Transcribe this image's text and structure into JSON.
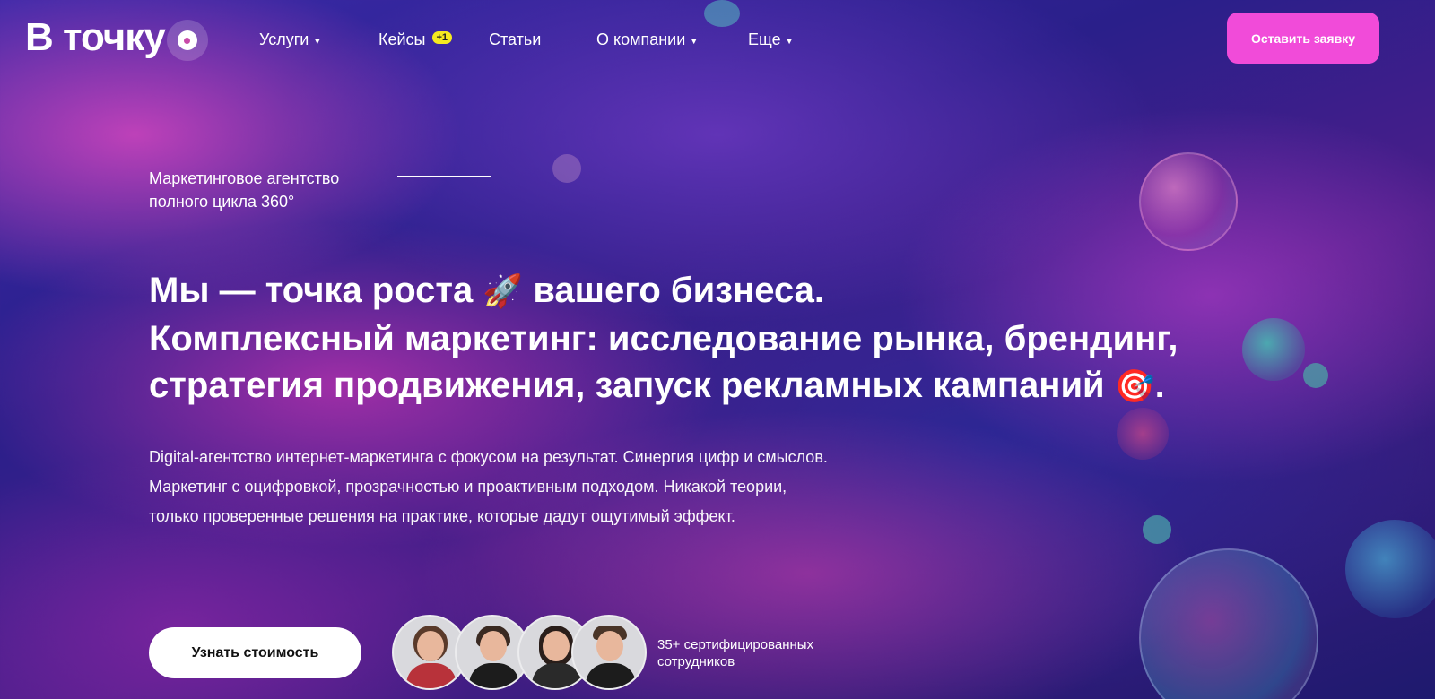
{
  "header": {
    "logo_text": "В точку",
    "nav": [
      {
        "label": "Услуги",
        "has_caret": true
      },
      {
        "label": "Кейсы",
        "badge": "+1"
      },
      {
        "label": "Статьи"
      },
      {
        "label": "О компании",
        "has_caret": true
      },
      {
        "label": "Еще",
        "has_caret": true
      }
    ],
    "cta_label": "Оставить заявку"
  },
  "hero": {
    "eyebrow_line1": "Маркетинговое агентство",
    "eyebrow_line2": "полного цикла 360°",
    "headline_line1_a": "Мы — точка роста",
    "headline_line1_b": "вашего бизнеса.",
    "headline_line2": "Комплексный маркетинг: исследование рынка, брендинг,",
    "headline_line3": "стратегия продвижения, запуск рекламных кампаний",
    "headline_line3_end": ".",
    "emoji_rocket": "🚀",
    "emoji_target": "🎯",
    "description": [
      "Digital-агентство интернет-маркетинга с фокусом на результат. Синергия цифр и смыслов.",
      "Маркетинг с оцифровкой, прозрачностью и проактивным подходом. Никакой теории,",
      "только проверенные решения на практике, которые дадут ощутимый эффект."
    ],
    "cta_label": "Узнать стоимость",
    "team_text_line1": "35+ сертифицированных",
    "team_text_line2": "сотрудников"
  },
  "colors": {
    "accent_pink": "#f14bd9",
    "badge_yellow": "#f5ea1f"
  }
}
